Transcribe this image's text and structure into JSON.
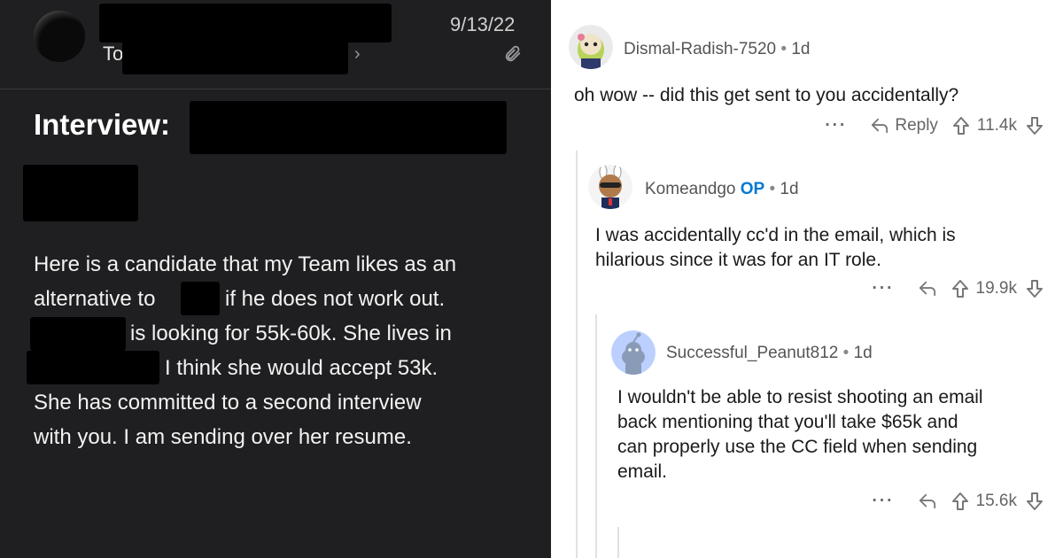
{
  "email": {
    "to_label": "To",
    "chevron": "›",
    "date": "9/13/22",
    "attachment_icon": "paperclip-icon",
    "subject": "Interview:",
    "body_lines": [
      "Here is a candidate that my Team likes as an",
      "alternative to",
      "if he does not work out.",
      "is looking for 55k-60k.  She lives in",
      "I think she would accept 53k.",
      "She has committed to a second interview",
      "with you.  I am sending over her resume."
    ]
  },
  "comments": [
    {
      "username": "Dismal-Radish-7520",
      "age": "1d",
      "text": "oh wow -- did this get sent to you accidentally?",
      "more": "···",
      "reply_label": "Reply",
      "score": "11.4k"
    },
    {
      "username": "Komeandgo",
      "op_tag": "OP",
      "age": "1d",
      "text_lines": [
        "I was accidentally cc'd in the email, which is",
        "hilarious since it was for an IT role."
      ],
      "more": "···",
      "score": "19.9k"
    },
    {
      "username": "Successful_Peanut812",
      "age": "1d",
      "text_lines": [
        "I wouldn't be able to resist shooting an email",
        "back mentioning that you'll take $65k and",
        "can properly use the CC field when sending",
        "email."
      ],
      "more": "···",
      "score": "15.6k"
    }
  ],
  "colors": {
    "email_bg": "#1f1f21",
    "op_blue": "#0079d3",
    "muted": "#666666"
  }
}
